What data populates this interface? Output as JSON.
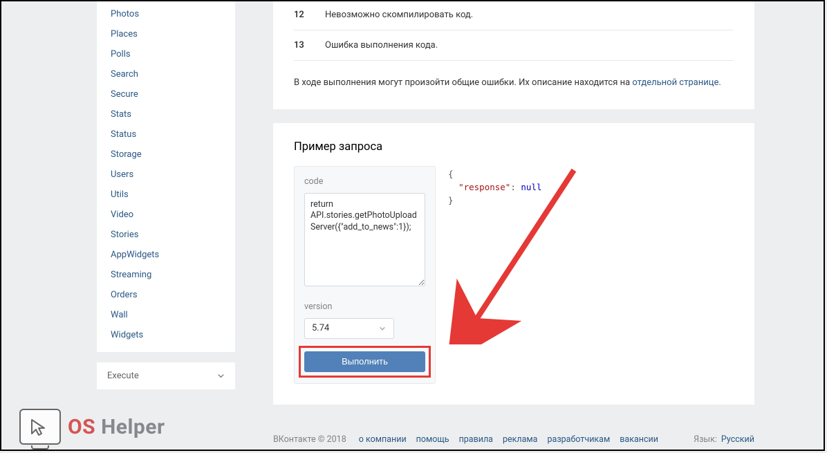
{
  "sidebar": {
    "items": [
      {
        "label": "Photos"
      },
      {
        "label": "Places"
      },
      {
        "label": "Polls"
      },
      {
        "label": "Search"
      },
      {
        "label": "Secure"
      },
      {
        "label": "Stats"
      },
      {
        "label": "Status"
      },
      {
        "label": "Storage"
      },
      {
        "label": "Users"
      },
      {
        "label": "Utils"
      },
      {
        "label": "Video"
      },
      {
        "label": "Stories"
      },
      {
        "label": "AppWidgets"
      },
      {
        "label": "Streaming"
      },
      {
        "label": "Orders"
      },
      {
        "label": "Wall"
      },
      {
        "label": "Widgets"
      }
    ],
    "execute_label": "Execute"
  },
  "errors": {
    "rows": [
      {
        "code": "12",
        "msg": "Невозможно скомпилировать код."
      },
      {
        "code": "13",
        "msg": "Ошибка выполнения кода."
      }
    ],
    "note_prefix": "В ходе выполнения могут произойти общие ошибки. Их описание находится на ",
    "note_link": "отдельной странице",
    "note_suffix": "."
  },
  "example": {
    "title": "Пример запроса",
    "code_label": "code",
    "code_value": "return API.stories.getPhotoUploadServer({\"add_to_news\":1});",
    "version_label": "version",
    "version_value": "5.74",
    "execute_label": "Выполнить",
    "response_key": "\"response\"",
    "response_value": "null"
  },
  "footer": {
    "copyright": "ВКонтакте © 2018",
    "links": [
      {
        "label": "о компании"
      },
      {
        "label": "помощь"
      },
      {
        "label": "правила"
      },
      {
        "label": "реклама"
      },
      {
        "label": "разработчикам"
      },
      {
        "label": "вакансии"
      }
    ],
    "lang_label": "Язык:",
    "lang_value": "Русский"
  },
  "watermark": {
    "os": "OS",
    "helper": " Helper"
  }
}
